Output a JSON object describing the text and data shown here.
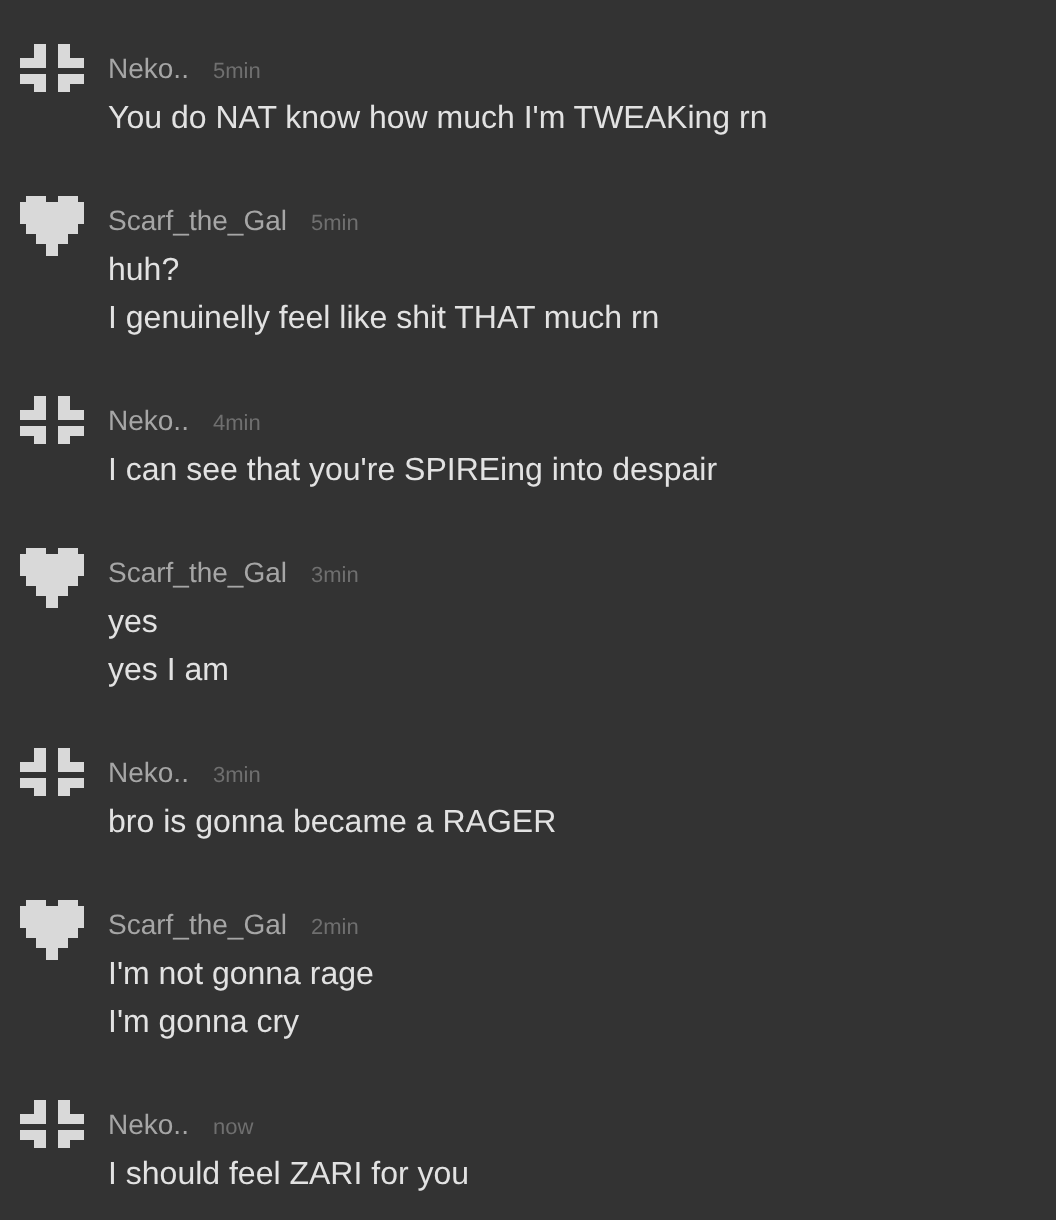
{
  "messages": [
    {
      "kind": "cross",
      "author": "Neko..",
      "time": "5min",
      "lines": [
        "You do NAT know how much I'm TWEAKing rn"
      ]
    },
    {
      "kind": "heart",
      "author": "Scarf_the_Gal",
      "time": "5min",
      "lines": [
        "huh?",
        "I genuinelly feel like shit THAT much rn"
      ]
    },
    {
      "kind": "cross",
      "author": "Neko..",
      "time": "4min",
      "lines": [
        "I can see that you're SPIREing into despair"
      ]
    },
    {
      "kind": "heart",
      "author": "Scarf_the_Gal",
      "time": "3min",
      "lines": [
        "yes",
        "yes I am"
      ]
    },
    {
      "kind": "cross",
      "author": "Neko..",
      "time": "3min",
      "lines": [
        "bro is gonna became a RAGER"
      ]
    },
    {
      "kind": "heart",
      "author": "Scarf_the_Gal",
      "time": "2min",
      "lines": [
        "I'm not gonna rage",
        "I'm gonna cry"
      ]
    },
    {
      "kind": "cross",
      "author": "Neko..",
      "time": "now",
      "lines": [
        "I should feel ZARI for you"
      ]
    }
  ]
}
